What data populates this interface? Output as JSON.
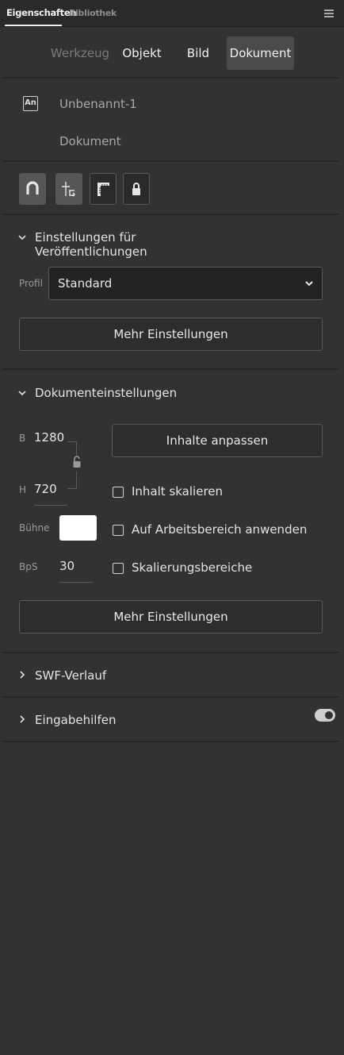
{
  "header": {
    "tabs": [
      {
        "label": "Eigenschaften",
        "active": true
      },
      {
        "label": "Bibliothek",
        "active": false
      }
    ],
    "collapse_glyph": "»",
    "menu_icon": "hamburger-menu-icon"
  },
  "mode_tabs": [
    {
      "label": "Werkzeug",
      "state": "disabled"
    },
    {
      "label": "Objekt",
      "state": "normal"
    },
    {
      "label": "Bild",
      "state": "normal"
    },
    {
      "label": "Dokument",
      "state": "selected"
    }
  ],
  "document": {
    "badge": "An",
    "name": "Unbenannt-1",
    "type": "Dokument"
  },
  "toolbar": {
    "buttons": [
      {
        "icon": "magnet-icon",
        "active": true
      },
      {
        "icon": "snap-guides-icon",
        "active": true
      },
      {
        "icon": "ruler-icon",
        "active": false
      },
      {
        "icon": "lock-icon",
        "active": false
      }
    ]
  },
  "publish": {
    "title": "Einstellungen für Veröffentlichungen",
    "expanded": true,
    "profile_label": "Profil",
    "profile_value": "Standard",
    "more_label": "Mehr Einstellungen"
  },
  "doc_settings": {
    "title": "Dokumenteinstellungen",
    "expanded": true,
    "width_label": "B",
    "width_value": "1280",
    "height_label": "H",
    "height_value": "720",
    "stage_label": "Bühne",
    "stage_color": "#ffffff",
    "fps_label": "BpS",
    "fps_value": "30",
    "fit_label": "Inhalte anpassen",
    "checkboxes": [
      {
        "label": "Inhalt skalieren",
        "checked": false
      },
      {
        "label": "Auf Arbeitsbereich anwenden",
        "checked": false
      },
      {
        "label": "Skalierungsbereiche",
        "checked": false
      }
    ],
    "more_label": "Mehr Einstellungen"
  },
  "swf_history": {
    "title": "SWF-Verlauf",
    "expanded": false
  },
  "accessibility": {
    "title": "Eingabehilfen",
    "expanded": false,
    "toggle_on": true
  },
  "colors": {
    "panel_bg": "#323232",
    "header_bg": "#2a2a2a",
    "selected_tab_bg": "#4a4a4a",
    "active_tool_bg": "#565656"
  }
}
